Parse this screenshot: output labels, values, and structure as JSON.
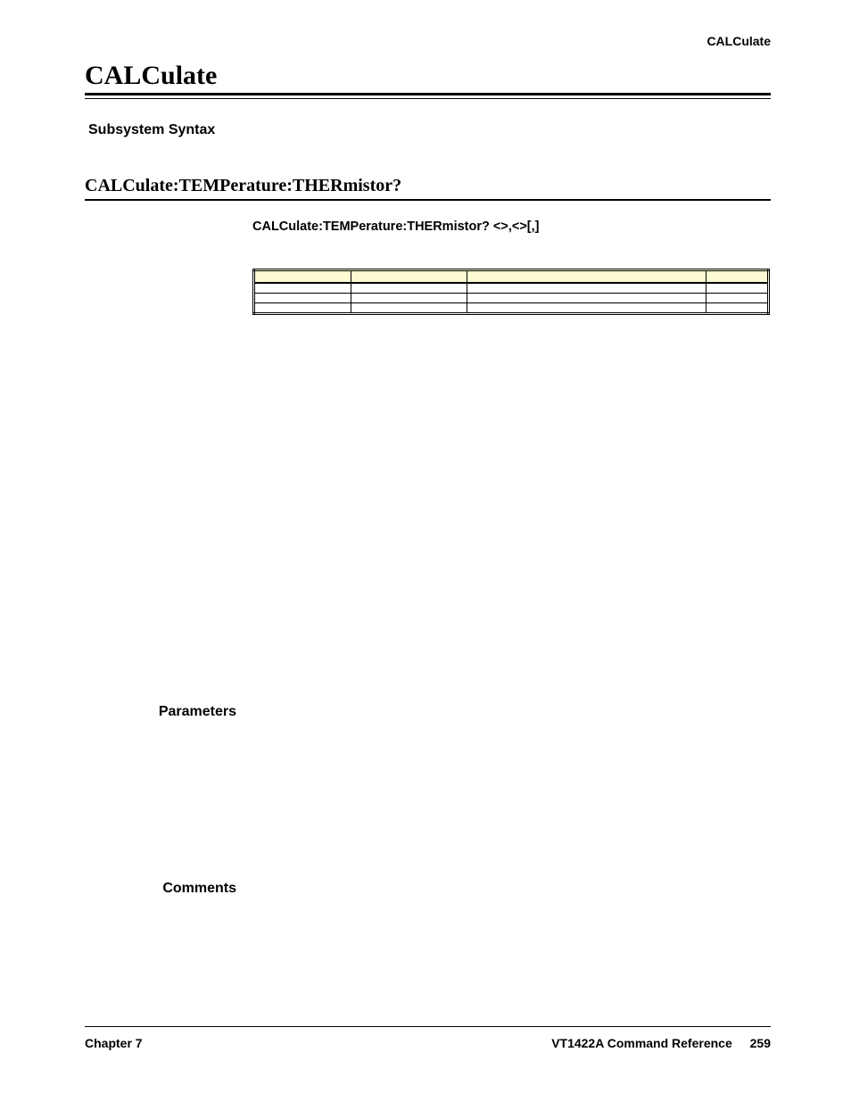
{
  "header": {
    "right": "CALCulate"
  },
  "title": "CALCulate",
  "intro": "",
  "subsystem_label": "Subsystem Syntax",
  "syntax": {
    "root": "",
    "child": ""
  },
  "section_heading": "CALCulate:TEMPerature:THERmistor?",
  "cmd": {
    "b1": "CALCulate:TEMPerature:THERmistor? <",
    "i1": "",
    "b2": ">,<",
    "i2": "",
    "b3": ">[,",
    "i3": "",
    "b4": "]"
  },
  "desc": "",
  "params_label": "Parameters",
  "table": {
    "headers": [
      "",
      "",
      "",
      ""
    ],
    "rows": [
      [
        "",
        "",
        "",
        ""
      ],
      [
        "",
        "",
        "",
        ""
      ],
      [
        "",
        "",
        "",
        ""
      ]
    ]
  },
  "comments_label": "Comments",
  "comments": {
    "line1": "",
    "line2": ""
  },
  "footer": {
    "left": "Chapter 7",
    "right_text": "VT1422A Command Reference",
    "page": "259"
  }
}
